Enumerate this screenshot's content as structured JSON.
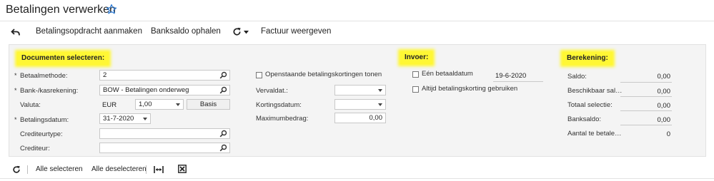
{
  "page": {
    "title": "Betalingen verwerken"
  },
  "toolbar": {
    "create_payment_order": "Betalingsopdracht aanmaken",
    "fetch_bank_balance": "Banksaldo ophalen",
    "show_invoice": "Factuur weergeven"
  },
  "sections": {
    "documents": "Documenten selecteren:",
    "input": "Invoer:",
    "calculation": "Berekening:"
  },
  "documents": {
    "payment_method": {
      "label": "Betaalmethode:",
      "value": "2",
      "required": true
    },
    "bank_account": {
      "label": "Bank-/kasrekening:",
      "value": "BOW - Betalingen onderweg",
      "required": true
    },
    "currency": {
      "label": "Valuta:",
      "code": "EUR",
      "rate": "1,00",
      "basis_button": "Basis"
    },
    "payment_date": {
      "label": "Betalingsdatum:",
      "value": "31-7-2020",
      "required": true
    },
    "creditor_type": {
      "label": "Crediteurtype:",
      "value": ""
    },
    "creditor": {
      "label": "Crediteur:",
      "value": ""
    },
    "show_discounts": {
      "label": "Openstaande betalingskortingen tonen",
      "checked": false
    },
    "due_date": {
      "label": "Vervaldat.:",
      "value": ""
    },
    "discount_date": {
      "label": "Kortingsdatum:",
      "value": ""
    },
    "max_amount": {
      "label": "Maximumbedrag:",
      "value": "0,00"
    }
  },
  "input": {
    "single_pay_date": {
      "label": "Eén betaaldatum",
      "checked": false,
      "value": "19-6-2020"
    },
    "always_discount": {
      "label": "Altijd betalingskorting gebruiken",
      "checked": false
    }
  },
  "calculation": {
    "rows": [
      {
        "label": "Saldo:",
        "value": "0,00"
      },
      {
        "label": "Beschikbaar sal…",
        "value": "0,00"
      },
      {
        "label": "Totaal selectie:",
        "value": "0,00"
      },
      {
        "label": "Banksaldo:",
        "value": "0,00"
      },
      {
        "label": "Aantal te betale…",
        "value": "0"
      }
    ]
  },
  "bottom_toolbar": {
    "select_all": "Alle selecteren",
    "deselect_all": "Alle deselecteren"
  },
  "icons": {
    "favorite": "star-icon",
    "undo": "undo-icon",
    "refresh": "refresh-icon",
    "lookup": "search-icon",
    "fit_columns": "fit-columns-icon",
    "clear": "clear-icon"
  },
  "colors": {
    "highlight": "#fff734",
    "accent": "#2b7bd6"
  }
}
